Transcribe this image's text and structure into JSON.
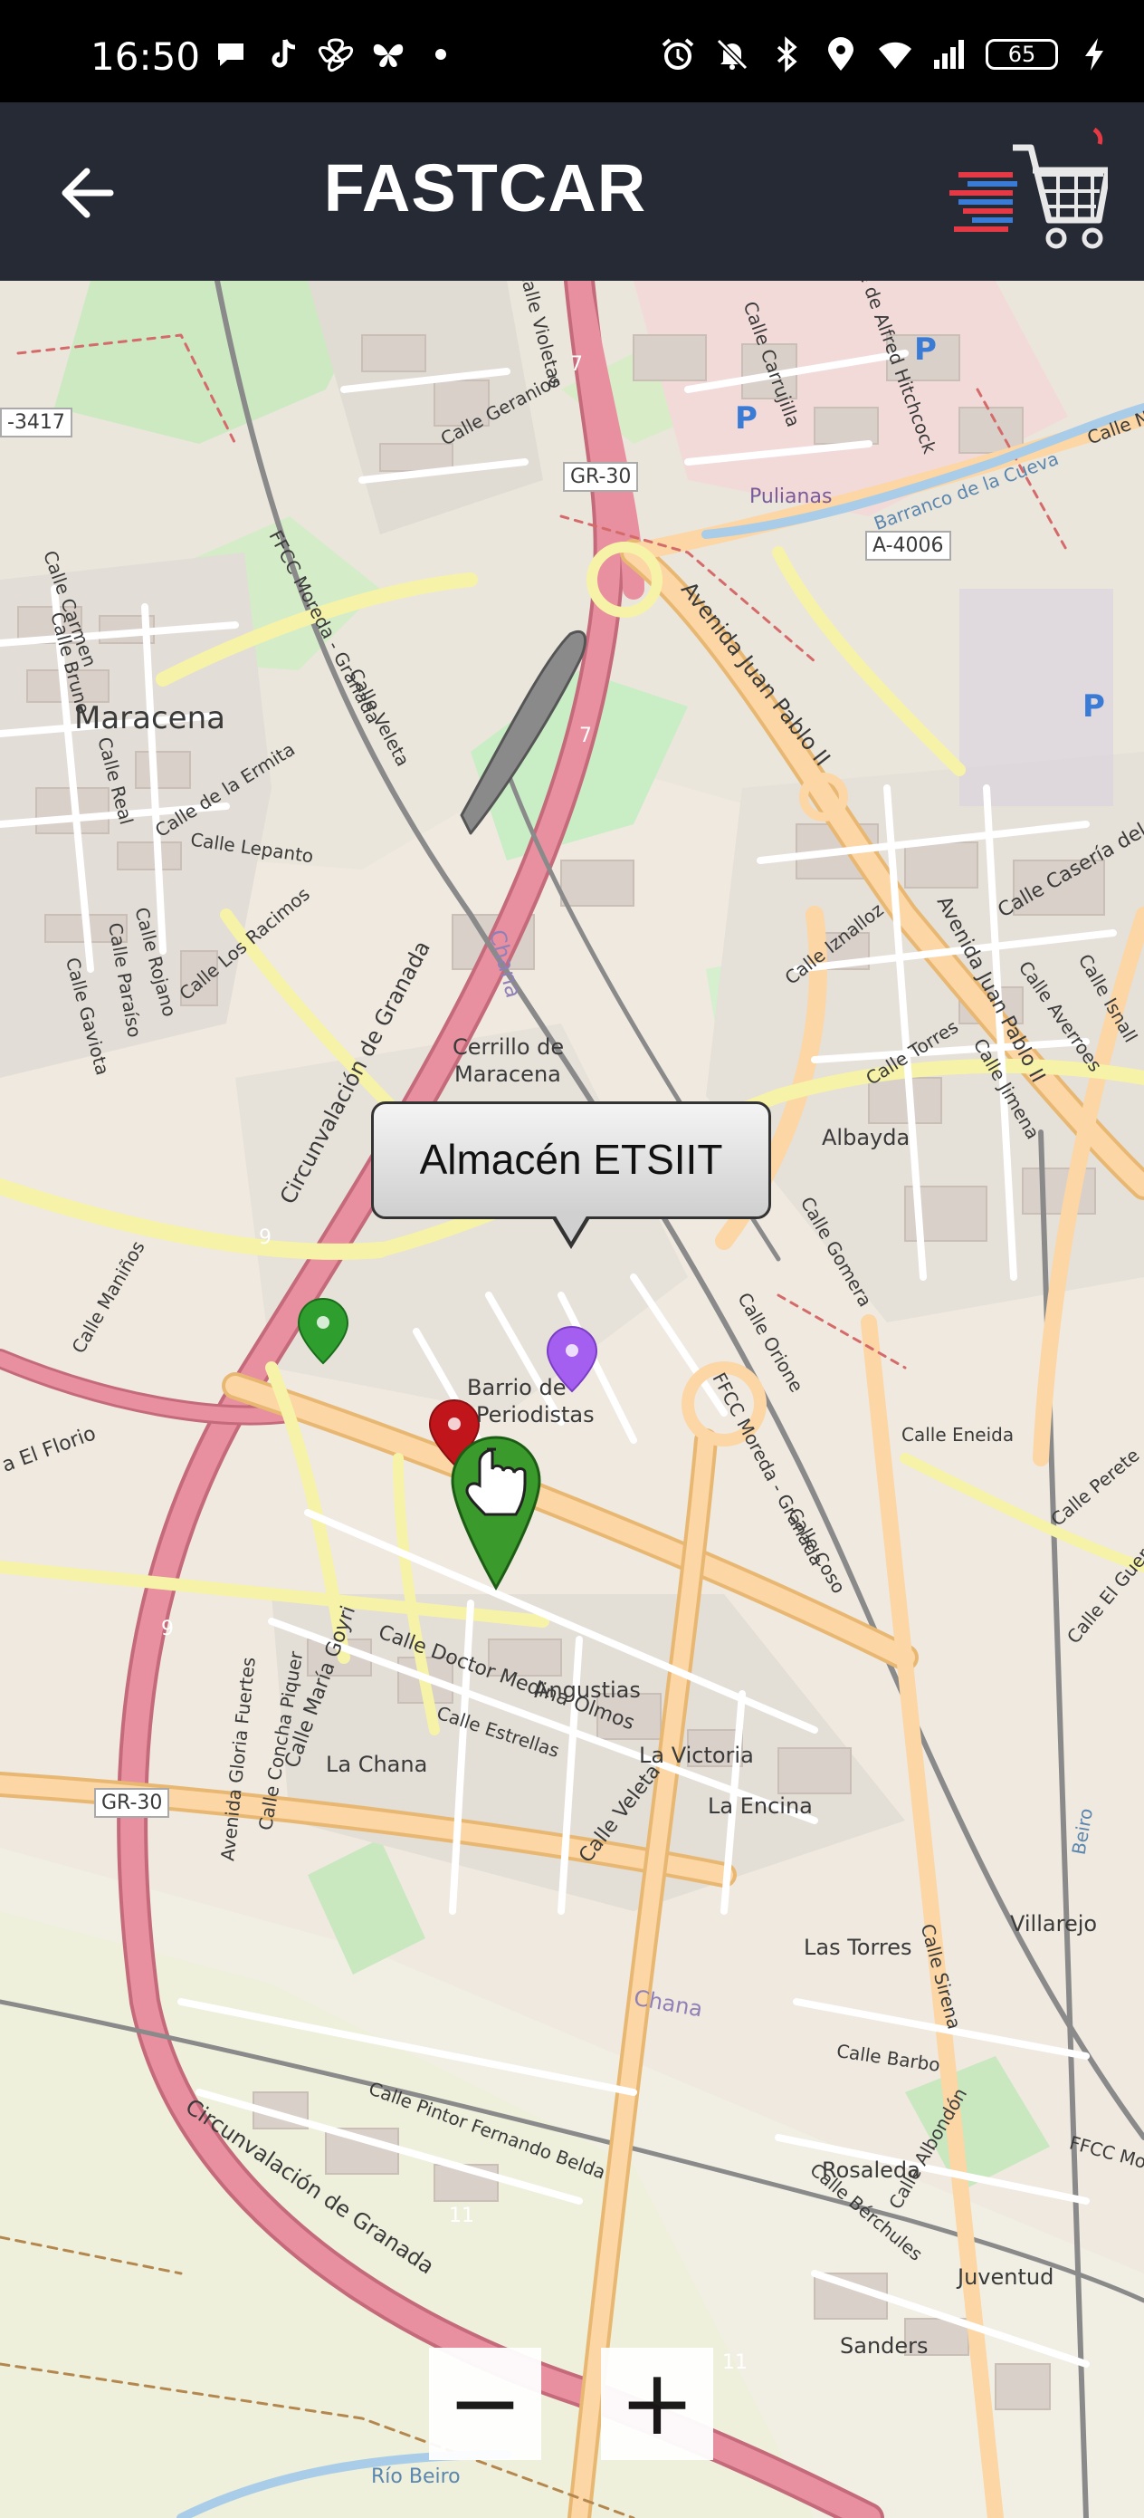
{
  "status_bar": {
    "time": "16:50",
    "battery": "65",
    "left_icons": [
      "chat-bubble-icon",
      "tiktok-icon",
      "pinwheel-icon",
      "butterfly-icon",
      "dot-icon"
    ],
    "right_icons": [
      "alarm-icon",
      "bell-off-icon",
      "bluetooth-icon",
      "location-icon",
      "wifi-icon",
      "signal-icon",
      "battery-icon",
      "charging-icon"
    ]
  },
  "app_bar": {
    "title": "FASTCAR",
    "back_icon": "arrow-left-icon",
    "logo_icon": "shopping-cart-logo-icon"
  },
  "map": {
    "popup_label": "Almacén ETSIIT",
    "markers": [
      {
        "name": "marker-green",
        "color": "#2e9e2e"
      },
      {
        "name": "marker-purple",
        "color": "#a45ef0"
      },
      {
        "name": "marker-red",
        "color": "#c0161b"
      },
      {
        "name": "marker-user-hand",
        "color": "#3a9a2b"
      }
    ],
    "labels": {
      "maracena": "Maracena",
      "cerrillo": "Cerrillo de",
      "maracena2": "Maracena",
      "albayda": "Albayda",
      "barrio": "Barrio de",
      "periodistas": "Periodistas",
      "angustias": "Angustias",
      "la_victoria": "La Victoria",
      "la_chana": "La Chana",
      "la_encina": "La Encina",
      "villarejo": "Villarejo",
      "las_torres": "Las Torres",
      "rosaleda": "Rosaleda",
      "juventud": "Juventud",
      "sanders": "Sanders",
      "pulianas": "Pulianas",
      "chana": "Chana",
      "chana2": "Chana",
      "gr30_top": "GR-30",
      "gr30_bottom": "GR-30",
      "a4006": "A-4006",
      "a3417": "-3417",
      "circ_top": "Circunvalación de Granada",
      "circ_bottom": "Circunvalación de Granada",
      "av_juan_pablo": "Avenida Juan Pablo II",
      "av_juan_pablo2": "Avenida Juan Pablo II",
      "calle_geranios": "Calle Geranios",
      "calle_violetas": "Calle Violetas",
      "calle_carmen": "Calle Carmen",
      "calle_bruno": "Calle Bruno",
      "calle_real": "Calle Real",
      "calle_ermita": "Calle de la Ermita",
      "calle_lepanto": "Calle Lepanto",
      "calle_racimos": "Calle Los Racimos",
      "calle_rojano": "Calle Rojano",
      "calle_paraiso": "Calle Paraíso",
      "calle_gaviota": "Calle Gaviota",
      "calle_velet": "Calle Veleta",
      "fcc_moreda": "FFCC Moreda - Granada",
      "fcc_moreda2": "FFCC Moreda - Granada",
      "fcc_moreda3": "FFCC Moreda",
      "calle_manios": "Calle Maniños",
      "calle_florio": "a El Florio",
      "calle_doctor": "Calle Doctor Medina Olmos",
      "calle_estrellas": "Calle Estrellas",
      "calle_maria_goyri": "Calle María Goyri",
      "calle_concha": "Calle Concha Piquer",
      "av_gloria": "Avenida Gloria Fuertes",
      "calle_veleta2": "Calle Veleta",
      "calle_eneida": "Calle Eneida",
      "calle_orione": "Calle Orione",
      "calle_coso": "Calle Coso",
      "calle_gomera": "Calle Gomera",
      "calle_torres": "Calle Torres",
      "calle_jimena": "Calle Jimena",
      "calle_izna": "Calle Iznalloz",
      "calle_caseria": "Calle Casería del Ce",
      "calle_averroes": "Calle Averroes",
      "calle_isnall": "Calle Isnall",
      "calle_sirena": "Calle Sirena",
      "calle_barbo": "Calle Barbo",
      "calle_albondon": "Calle Albondón",
      "calle_berchules": "Calle Bérchules",
      "calle_pintor": "Calle Pintor Fernando Belda",
      "calle_perete": "Calle Perete",
      "calle_guer": "Calle El Guer",
      "calle_carrujilla": "Calle Carrujilla",
      "calle_hitchcock": "Calle de Alfred Hitchcock",
      "barranco": "Barranco de la Cueva",
      "calle_n": "Calle N",
      "rio_beiro": "Río Beiro",
      "beiro": "Beiro",
      "num7a": "7",
      "num7b": "7",
      "num9a": "9",
      "num9b": "9",
      "num11a": "11",
      "num11b": "11",
      "p1": "P",
      "p2": "P",
      "p3": "P"
    }
  },
  "zoom": {
    "minus": "−",
    "plus": "+"
  }
}
